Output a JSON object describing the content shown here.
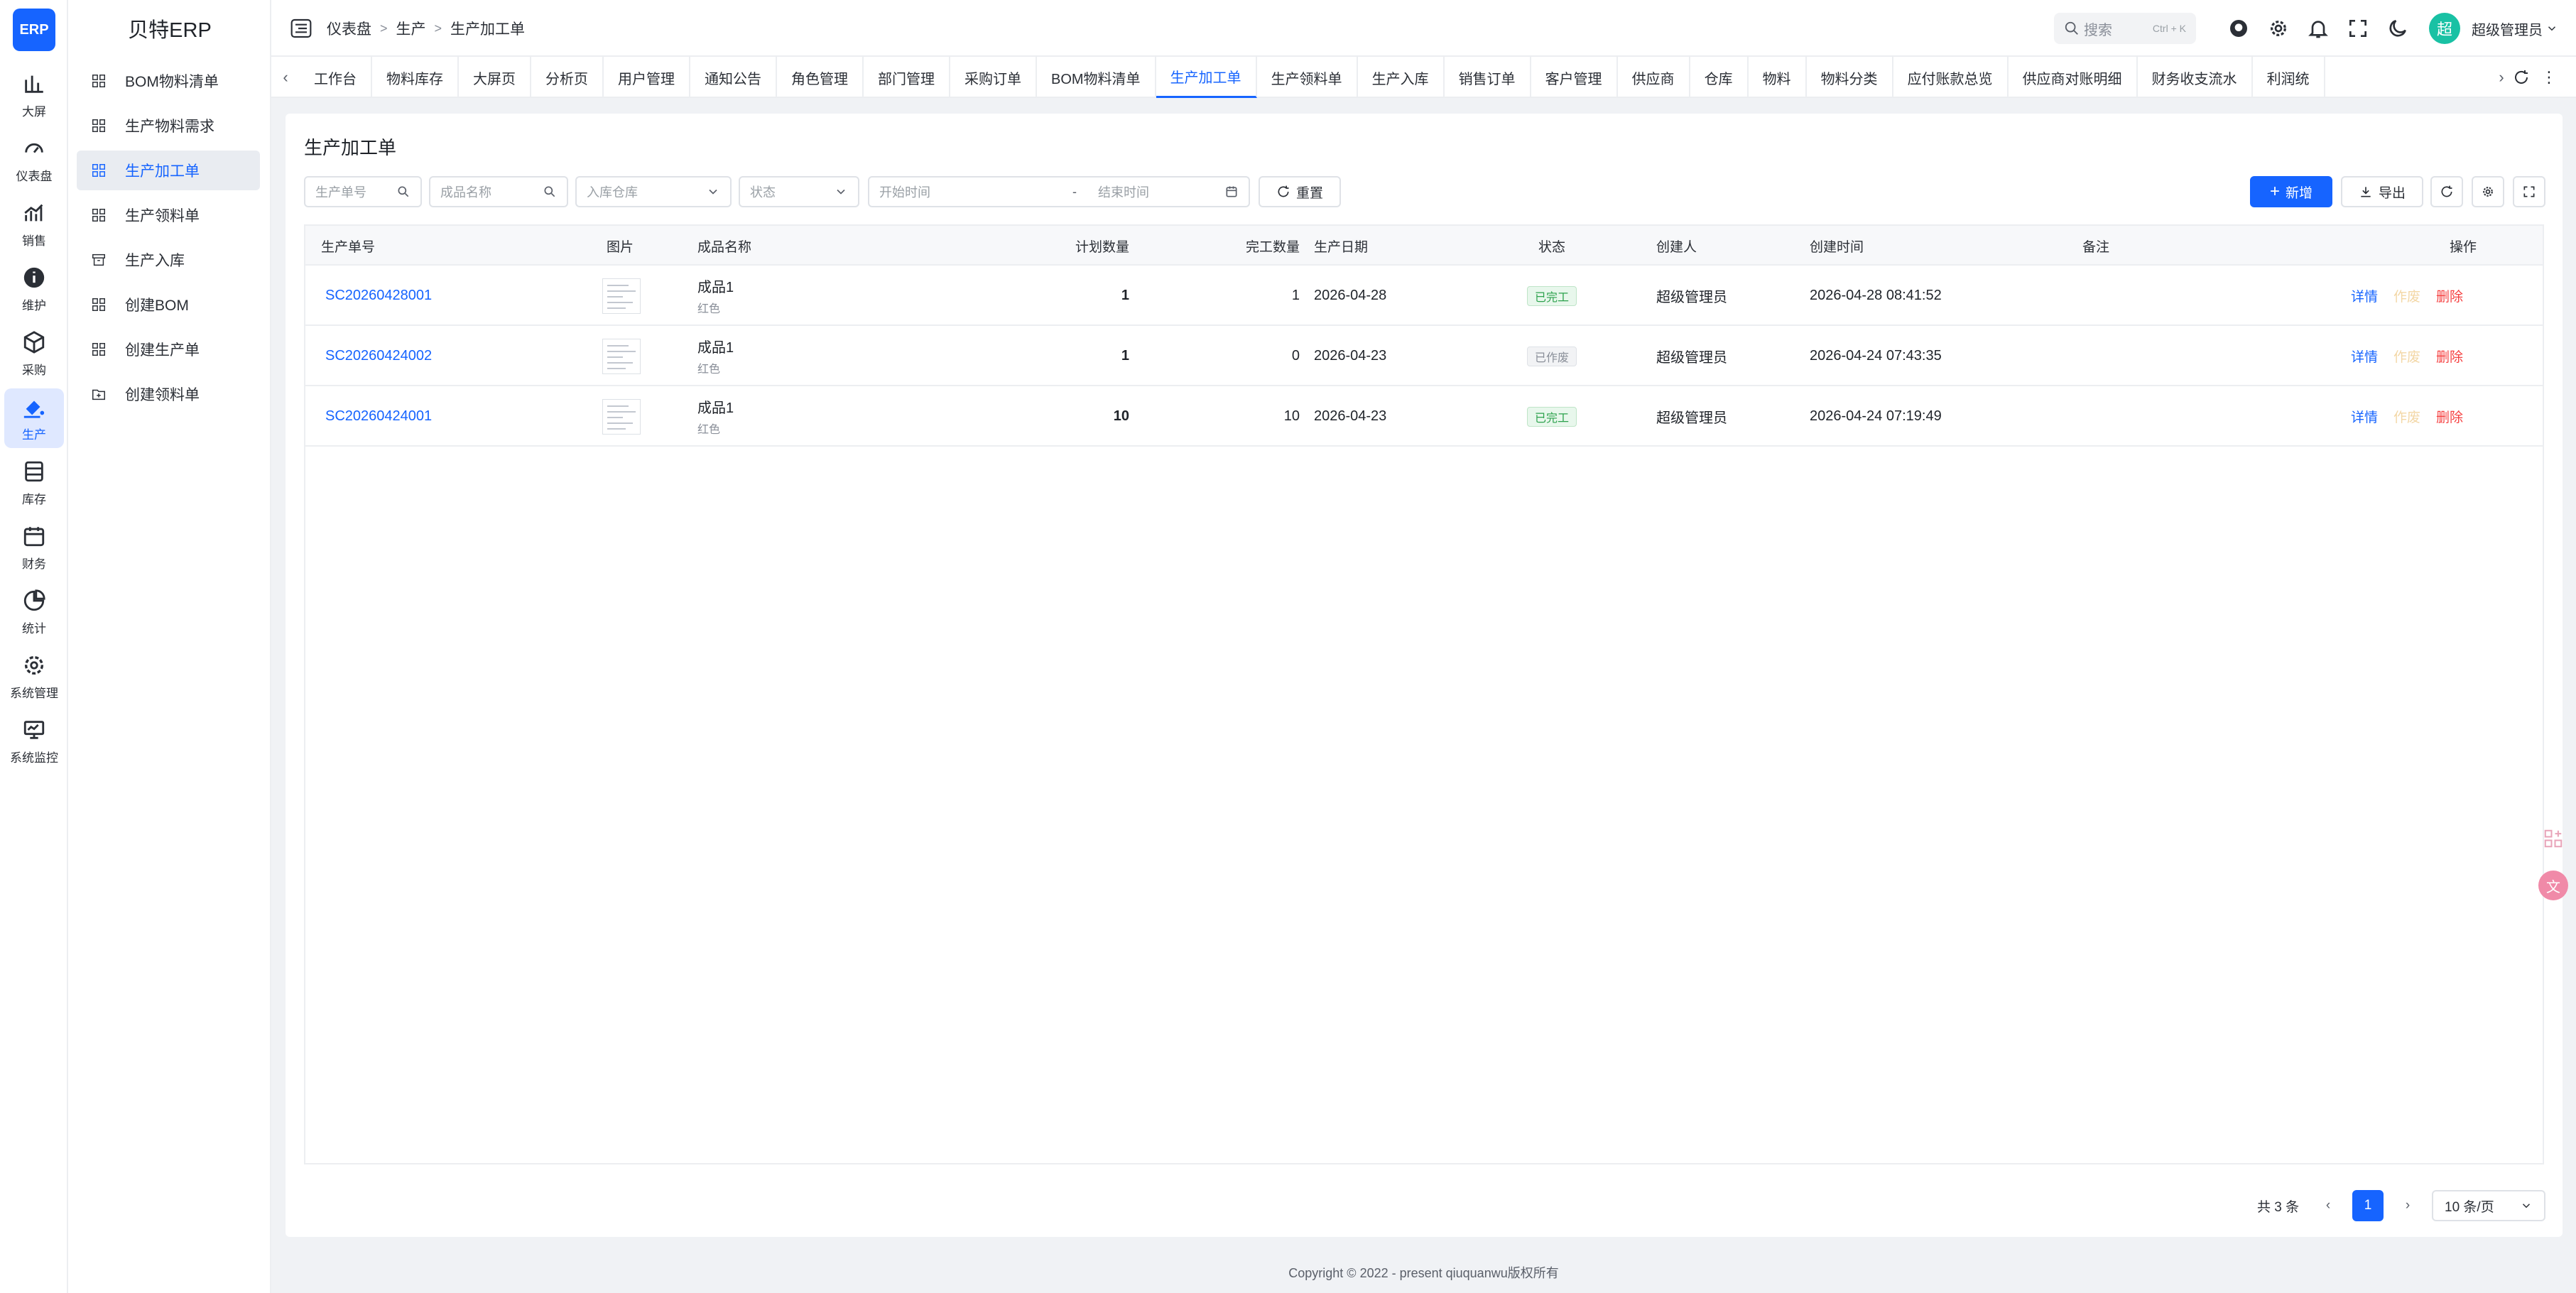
{
  "app": {
    "logo_text": "ERP",
    "brand": "贝特ERP"
  },
  "rail": [
    {
      "label": "大屏",
      "icon": "bar-chart-icon"
    },
    {
      "label": "仪表盘",
      "icon": "dashboard-icon"
    },
    {
      "label": "销售",
      "icon": "sales-icon"
    },
    {
      "label": "维护",
      "icon": "info-icon"
    },
    {
      "label": "采购",
      "icon": "cube-icon"
    },
    {
      "label": "生产",
      "icon": "production-icon",
      "active": true
    },
    {
      "label": "库存",
      "icon": "inventory-icon"
    },
    {
      "label": "财务",
      "icon": "calendar-icon"
    },
    {
      "label": "统计",
      "icon": "pie-chart-icon"
    },
    {
      "label": "系统管理",
      "icon": "gear-icon"
    },
    {
      "label": "系统监控",
      "icon": "monitor-icon"
    }
  ],
  "sidebar": [
    {
      "label": "BOM物料清单"
    },
    {
      "label": "生产物料需求"
    },
    {
      "label": "生产加工单",
      "active": true
    },
    {
      "label": "生产领料单"
    },
    {
      "label": "生产入库"
    },
    {
      "label": "创建BOM"
    },
    {
      "label": "创建生产单"
    },
    {
      "label": "创建领料单"
    }
  ],
  "breadcrumb": [
    "仪表盘",
    "生产",
    "生产加工单"
  ],
  "header": {
    "search_label": "搜索",
    "search_kbd": "Ctrl + K",
    "avatar": "超",
    "user": "超级管理员"
  },
  "tabs": [
    "工作台",
    "物料库存",
    "大屏页",
    "分析页",
    "用户管理",
    "通知公告",
    "角色管理",
    "部门管理",
    "采购订单",
    "BOM物料清单",
    "生产加工单",
    "生产领料单",
    "生产入库",
    "销售订单",
    "客户管理",
    "供应商",
    "仓库",
    "物料",
    "物料分类",
    "应付账款总览",
    "供应商对账明细",
    "财务收支流水",
    "利润统"
  ],
  "active_tab": "生产加工单",
  "page": {
    "title": "生产加工单",
    "filters": {
      "order_no": "生产单号",
      "product_name": "成品名称",
      "warehouse": "入库仓库",
      "status": "状态",
      "start_time": "开始时间",
      "range_sep": "-",
      "end_time": "结束时间"
    },
    "buttons": {
      "reset": "重置",
      "add": "新增",
      "export": "导出"
    }
  },
  "table": {
    "columns": [
      "生产单号",
      "图片",
      "成品名称",
      "计划数量",
      "完工数量",
      "生产日期",
      "状态",
      "创建人",
      "创建时间",
      "备注",
      "操作"
    ],
    "rows": [
      {
        "order_no": "SC20260428001",
        "product": "成品1",
        "color": "红色",
        "plan_qty": "1",
        "done_qty": "1",
        "date": "2026-04-28",
        "status": "已完工",
        "status_kind": "done",
        "creator": "超级管理员",
        "created": "2026-04-28 08:41:52",
        "remark": ""
      },
      {
        "order_no": "SC20260424002",
        "product": "成品1",
        "color": "红色",
        "plan_qty": "1",
        "done_qty": "0",
        "date": "2026-04-23",
        "status": "已作废",
        "status_kind": "void",
        "creator": "超级管理员",
        "created": "2026-04-24 07:43:35",
        "remark": ""
      },
      {
        "order_no": "SC20260424001",
        "product": "成品1",
        "color": "红色",
        "plan_qty": "10",
        "done_qty": "10",
        "date": "2026-04-23",
        "status": "已完工",
        "status_kind": "done",
        "creator": "超级管理员",
        "created": "2026-04-24 07:19:49",
        "remark": ""
      }
    ],
    "actions": {
      "detail": "详情",
      "void": "作废",
      "delete": "删除"
    }
  },
  "pagination": {
    "total": "共 3 条",
    "current": "1",
    "page_size": "10 条/页"
  },
  "footer": "Copyright © 2022 - present qiuquanwu版权所有",
  "colors": {
    "primary": "#1664ff",
    "success": "#2ca24c",
    "danger": "#f53f3f"
  }
}
